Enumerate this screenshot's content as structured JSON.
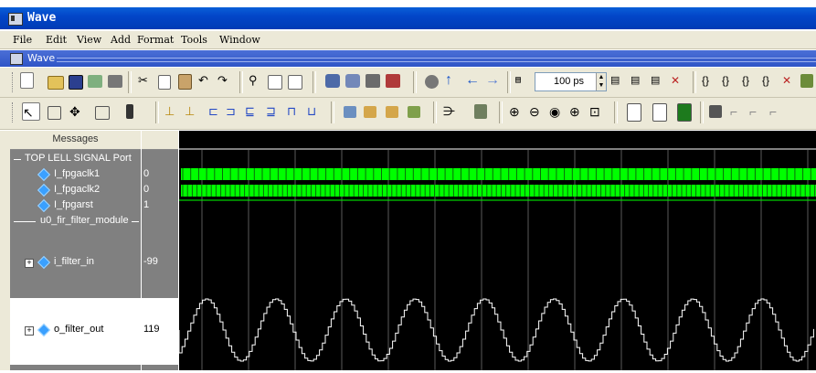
{
  "window": {
    "title": "Wave"
  },
  "menu": [
    "File",
    "Edit",
    "View",
    "Add",
    "Format",
    "Tools",
    "Window"
  ],
  "subwindow": {
    "title": "Wave"
  },
  "toolbar": {
    "zoom_value": "100 ps"
  },
  "panes": {
    "messages_header": "Messages"
  },
  "signals": [
    {
      "label": "TOP LELL SIGNAL Port",
      "kind": "divider",
      "value": ""
    },
    {
      "label": "I_fpgaclk1",
      "kind": "signal",
      "value": "0"
    },
    {
      "label": "I_fpgaclk2",
      "kind": "signal",
      "value": "0"
    },
    {
      "label": "I_fpgarst",
      "kind": "signal",
      "value": "1"
    },
    {
      "label": "u0_fir_filter_module",
      "kind": "divider",
      "value": ""
    },
    {
      "label": "i_filter_in",
      "kind": "bus",
      "value": "-99"
    },
    {
      "label": "o_filter_out",
      "kind": "bus",
      "value": "119"
    }
  ],
  "colors": {
    "clock": "#00ff00",
    "analog": "#ffffff",
    "selected_row": "#ffffff"
  }
}
